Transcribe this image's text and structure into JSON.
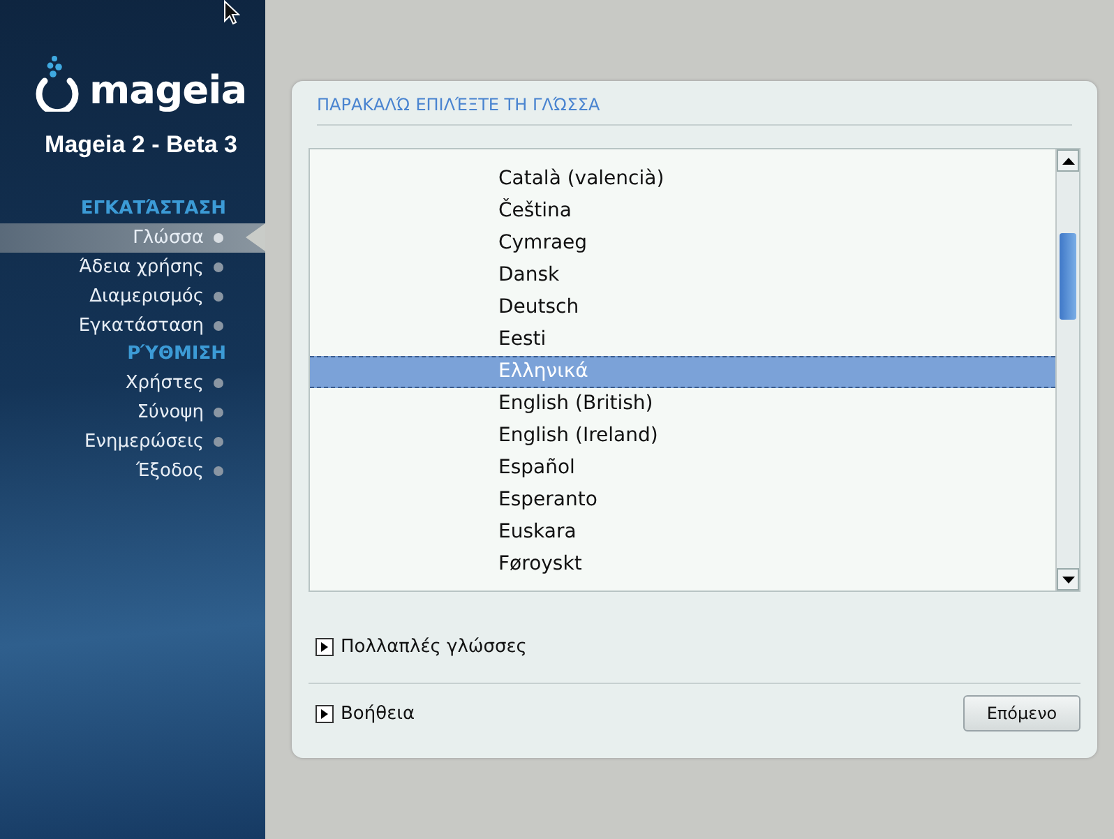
{
  "sidebar": {
    "logo_text": "mageia",
    "version": "Mageia 2 - Beta 3",
    "sections": [
      {
        "title": "ΕΓΚΑΤΆΣΤΑΣΗ",
        "items": [
          {
            "label": "Γλώσσα",
            "selected": true
          },
          {
            "label": "Άδεια χρήσης",
            "selected": false
          },
          {
            "label": "Διαμερισμός",
            "selected": false
          },
          {
            "label": "Εγκατάσταση",
            "selected": false
          }
        ]
      },
      {
        "title": "ΡΎΘΜΙΣΗ",
        "items": [
          {
            "label": "Χρήστες",
            "selected": false
          },
          {
            "label": "Σύνοψη",
            "selected": false
          },
          {
            "label": "Ενημερώσεις",
            "selected": false
          },
          {
            "label": "Έξοδος",
            "selected": false
          }
        ]
      }
    ]
  },
  "panel": {
    "title": "ΠΑΡΑΚΑΛΏ ΕΠΙΛΈΞΤΕ ΤΗ ΓΛΏΣΣΑ",
    "languages": [
      {
        "label": "Català (valencià)",
        "selected": false
      },
      {
        "label": "Čeština",
        "selected": false
      },
      {
        "label": "Cymraeg",
        "selected": false
      },
      {
        "label": "Dansk",
        "selected": false
      },
      {
        "label": "Deutsch",
        "selected": false
      },
      {
        "label": "Eesti",
        "selected": false
      },
      {
        "label": "Ελληνικά",
        "selected": true
      },
      {
        "label": "English (British)",
        "selected": false
      },
      {
        "label": "English (Ireland)",
        "selected": false
      },
      {
        "label": "Español",
        "selected": false
      },
      {
        "label": "Esperanto",
        "selected": false
      },
      {
        "label": "Euskara",
        "selected": false
      },
      {
        "label": "Føroyskt",
        "selected": false
      }
    ],
    "multiple_languages": {
      "label": "Πολλαπλές γλώσσες",
      "expanded": false
    },
    "help": {
      "label": "Βοήθεια",
      "expanded": false
    },
    "next_button": "Επόμενο"
  }
}
